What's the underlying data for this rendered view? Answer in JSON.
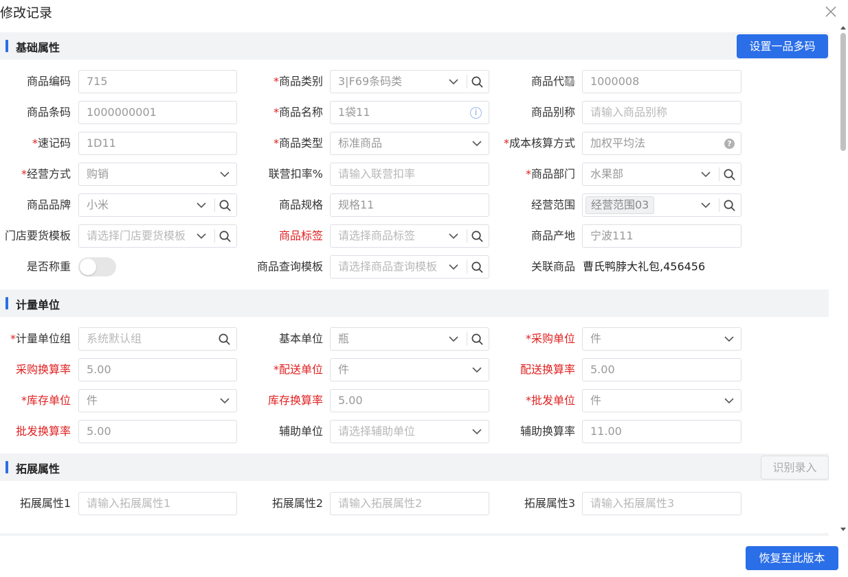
{
  "modal": {
    "title": "修改记录"
  },
  "sections": {
    "basic": {
      "title": "基础属性",
      "action": "设置一品多码"
    },
    "unit": {
      "title": "计量单位"
    },
    "ext": {
      "title": "拓展属性",
      "action": "识别录入"
    }
  },
  "basic": {
    "product_code": {
      "label": "商品编码",
      "value": "715"
    },
    "category": {
      "label": "商品类别",
      "value": "3|F69条码类"
    },
    "code": {
      "label": "商品代码",
      "value": "1000008"
    },
    "barcode": {
      "label": "商品条码",
      "value": "1000000001"
    },
    "name": {
      "label": "商品名称",
      "value": "1袋11"
    },
    "alias": {
      "label": "商品别称",
      "placeholder": "请输入商品别称"
    },
    "quick_code": {
      "label": "速记码",
      "value": "1D11"
    },
    "type": {
      "label": "商品类型",
      "value": "标准商品"
    },
    "cost_method": {
      "label": "成本核算方式",
      "value": "加权平均法"
    },
    "biz_mode": {
      "label": "经营方式",
      "value": "购销"
    },
    "joint_rate": {
      "label": "联营扣率%",
      "placeholder": "请输入联营扣率"
    },
    "dept": {
      "label": "商品部门",
      "value": "水果部"
    },
    "brand": {
      "label": "商品品牌",
      "value": "小米"
    },
    "spec": {
      "label": "商品规格",
      "value": "规格11"
    },
    "scope": {
      "label": "经营范围",
      "tag": "经营范围03"
    },
    "order_tpl": {
      "label": "门店要货模板",
      "placeholder": "请选择门店要货模板"
    },
    "tag": {
      "label": "商品标签",
      "placeholder": "请选择商品标签"
    },
    "origin": {
      "label": "商品产地",
      "value": "宁波111"
    },
    "weighing": {
      "label": "是否称重",
      "on": false
    },
    "query_tpl": {
      "label": "商品查询模板",
      "placeholder": "请选择商品查询模板"
    },
    "related": {
      "label": "关联商品",
      "value": "曹氏鸭脖大礼包,456456"
    }
  },
  "unit": {
    "group": {
      "label": "计量单位组",
      "placeholder": "系统默认组"
    },
    "base": {
      "label": "基本单位",
      "value": "瓶"
    },
    "purchase": {
      "label": "采购单位",
      "value": "件"
    },
    "purchase_rate": {
      "label": "采购换算率",
      "value": "5.00"
    },
    "delivery": {
      "label": "配送单位",
      "value": "件"
    },
    "delivery_rate": {
      "label": "配送换算率",
      "value": "5.00"
    },
    "stock": {
      "label": "库存单位",
      "value": "件"
    },
    "stock_rate": {
      "label": "库存换算率",
      "value": "5.00"
    },
    "wholesale": {
      "label": "批发单位",
      "value": "件"
    },
    "wholesale_rate": {
      "label": "批发换算率",
      "value": "5.00"
    },
    "aux": {
      "label": "辅助单位",
      "placeholder": "请选择辅助单位"
    },
    "aux_rate": {
      "label": "辅助换算率",
      "value": "11.00"
    }
  },
  "ext": {
    "attr1": {
      "label": "拓展属性1",
      "placeholder": "请输入拓展属性1"
    },
    "attr2": {
      "label": "拓展属性2",
      "placeholder": "请输入拓展属性2"
    },
    "attr3": {
      "label": "拓展属性3",
      "placeholder": "请输入拓展属性3"
    }
  },
  "footer": {
    "restore": "恢复至此版本"
  },
  "colors": {
    "primary": "#2a6ee8",
    "required": "#e02020",
    "section_bg": "#f2f3f5"
  }
}
